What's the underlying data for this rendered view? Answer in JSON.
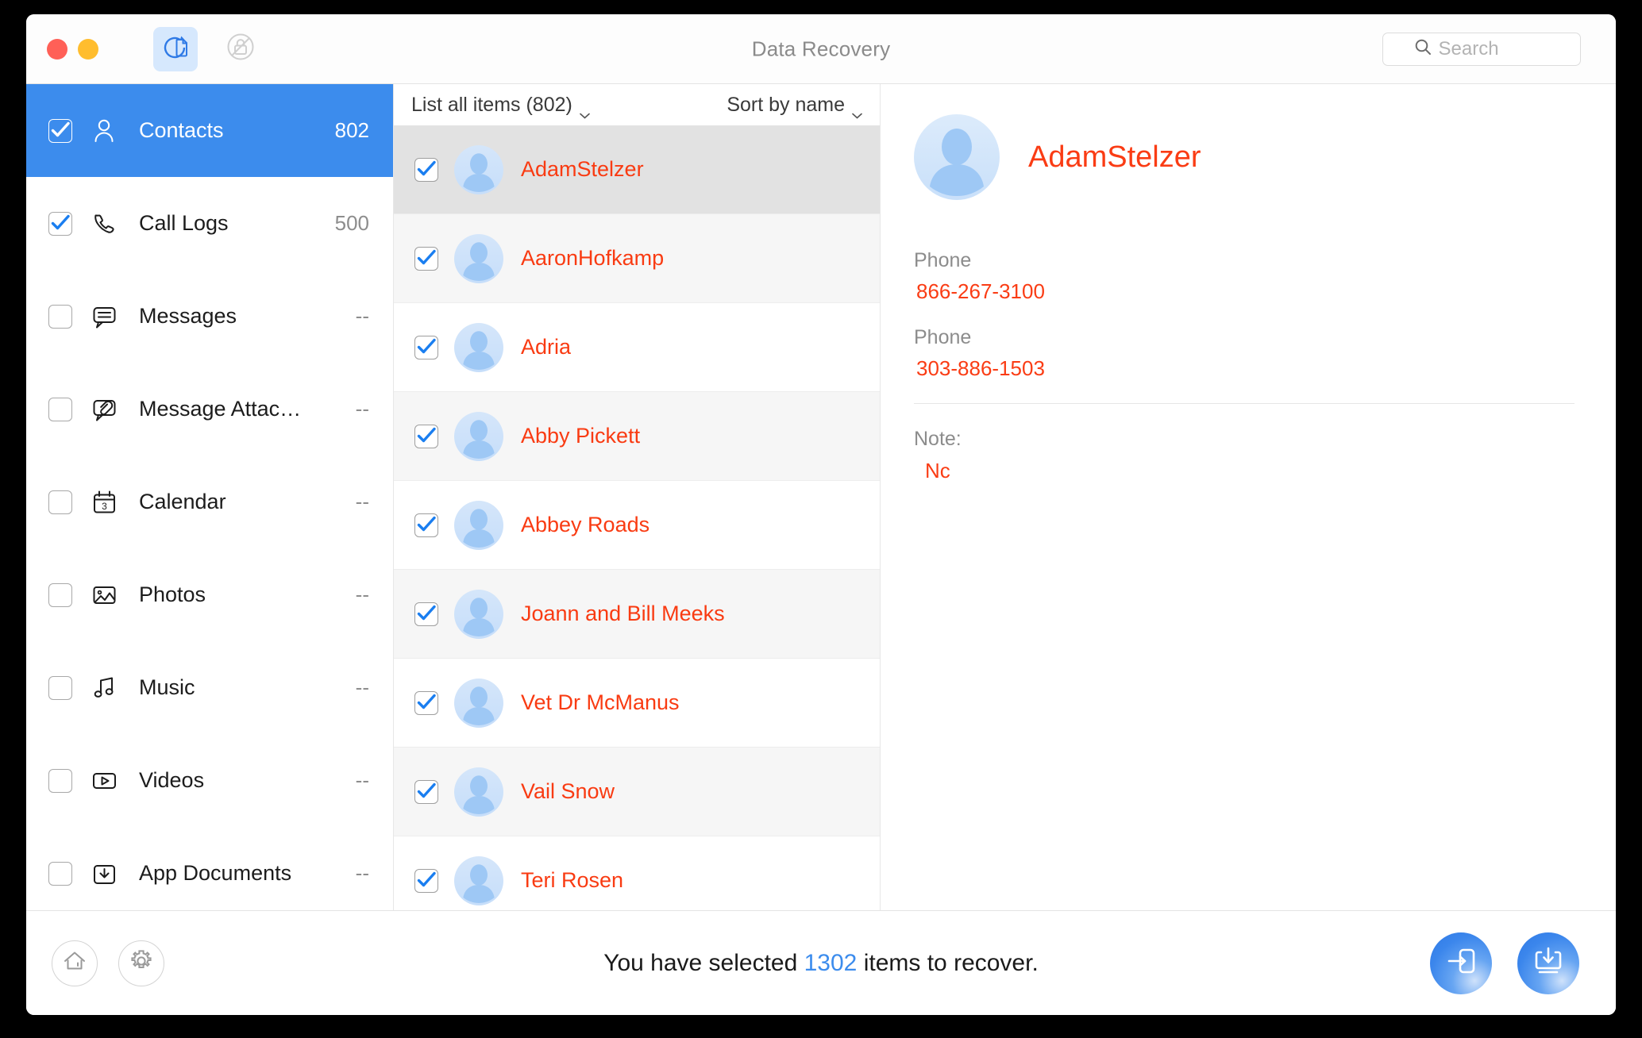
{
  "window": {
    "title": "Data Recovery",
    "traffic_lights": [
      "close",
      "minimize"
    ]
  },
  "toolbar": {
    "buttons": [
      {
        "name": "data-recovery-mode",
        "icon": "document-refresh-icon",
        "active": true
      },
      {
        "name": "unlock-mode",
        "icon": "locked-disabled-icon",
        "active": false
      }
    ]
  },
  "search": {
    "placeholder": "Search",
    "value": "",
    "icon": "search-icon"
  },
  "sidebar": {
    "items": [
      {
        "label": "Contacts",
        "count": "802",
        "icon": "person-icon",
        "checked": true,
        "active": true
      },
      {
        "label": "Call Logs",
        "count": "500",
        "icon": "phone-icon",
        "checked": true,
        "active": false
      },
      {
        "label": "Messages",
        "count": "--",
        "icon": "message-icon",
        "checked": false,
        "active": false
      },
      {
        "label": "Message Attac…",
        "count": "--",
        "icon": "attachment-icon",
        "checked": false,
        "active": false
      },
      {
        "label": "Calendar",
        "count": "--",
        "icon": "calendar-icon",
        "checked": false,
        "active": false
      },
      {
        "label": "Photos",
        "count": "--",
        "icon": "photo-icon",
        "checked": false,
        "active": false
      },
      {
        "label": "Music",
        "count": "--",
        "icon": "music-icon",
        "checked": false,
        "active": false
      },
      {
        "label": "Videos",
        "count": "--",
        "icon": "video-icon",
        "checked": false,
        "active": false
      },
      {
        "label": "App Documents",
        "count": "--",
        "icon": "app-document-icon",
        "checked": false,
        "active": false
      }
    ]
  },
  "list_header": {
    "filter_label": "List all items (802)",
    "sort_label": "Sort by name",
    "chevron_icon": "chevron-down-icon"
  },
  "contacts": [
    {
      "name": "AdamStelzer",
      "checked": true,
      "selected": true
    },
    {
      "name": "AaronHofkamp",
      "checked": true,
      "selected": false
    },
    {
      "name": "Adria",
      "checked": true,
      "selected": false
    },
    {
      "name": "Abby Pickett",
      "checked": true,
      "selected": false
    },
    {
      "name": "Abbey Roads",
      "checked": true,
      "selected": false
    },
    {
      "name": "Joann and Bill Meeks",
      "checked": true,
      "selected": false
    },
    {
      "name": "Vet Dr McManus",
      "checked": true,
      "selected": false
    },
    {
      "name": "Vail Snow",
      "checked": true,
      "selected": false
    },
    {
      "name": "Teri Rosen",
      "checked": true,
      "selected": false
    }
  ],
  "detail": {
    "name": "AdamStelzer",
    "avatar_icon": "person-avatar-icon",
    "fields": [
      {
        "label": "Phone",
        "value": "866-267-3100"
      },
      {
        "label": "Phone",
        "value": "303-886-1503"
      }
    ],
    "note_label": "Note:",
    "note_value": "Nc"
  },
  "footer": {
    "home_icon": "home-icon",
    "settings_icon": "gear-icon",
    "status_prefix": "You have selected ",
    "status_count": "1302",
    "status_suffix": " items to recover.",
    "actions": [
      {
        "name": "recover-to-device-button",
        "icon": "arrow-into-phone-icon"
      },
      {
        "name": "recover-to-computer-button",
        "icon": "download-to-computer-icon"
      }
    ]
  },
  "colors": {
    "accent_blue": "#3c8ced",
    "contact_red": "#f93b12",
    "traffic_close": "#ff6057",
    "traffic_min": "#ffbd2e"
  }
}
